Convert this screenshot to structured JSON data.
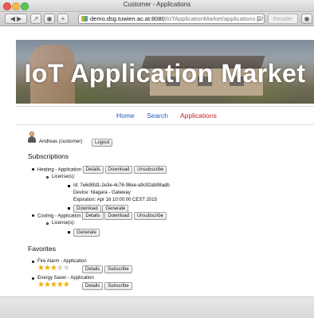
{
  "window": {
    "title": "Customer - Applications"
  },
  "toolbar": {
    "url_host": "demo.dsg.tuwien.ac.at:8080",
    "url_path": "/IoTApplicationMarket/applications.jsf",
    "reload_glyph": "C",
    "reader_label": "Reader",
    "add_glyph": "+"
  },
  "banner": {
    "title": "IoT Application Market"
  },
  "nav": {
    "items": [
      "Home",
      "Search",
      "Applications"
    ],
    "active": "Applications",
    "link_color": "#2255bb",
    "active_color": "#c62020"
  },
  "user": {
    "label": "Andreas (customer)",
    "logout_label": "Logout"
  },
  "subscriptions": {
    "heading": "Subscriptions",
    "items": [
      {
        "title": "Heating - Application",
        "buttons": [
          "Details",
          "Download",
          "Unsubscribe"
        ],
        "licenses_label": "License(s):",
        "license": {
          "id_line": "Id: 7e6d5fd1-2e3e-4c76-98ee-a9c92ab98adb",
          "device_line": "Device: Niagara - Gateway",
          "expiration_line": "Expiration: Apr 16 10:00:00 CEST 2015",
          "buttons": [
            "Download",
            "Generate"
          ]
        }
      },
      {
        "title": "Cooling - Application",
        "buttons": [
          "Details",
          "Download",
          "Unsubscribe"
        ],
        "licenses_label": "License(s):",
        "generate_label": "Generate"
      }
    ]
  },
  "favorites": {
    "heading": "Favorites",
    "items": [
      {
        "title": "Fire Alarm - Application",
        "rating": 3,
        "max_rating": 5,
        "buttons": [
          "Details",
          "Subscribe"
        ]
      },
      {
        "title": "Energy Saver - Application",
        "rating": 5,
        "max_rating": 5,
        "buttons": [
          "Details",
          "Subscribe"
        ]
      }
    ]
  },
  "colors": {
    "star_on": "#f0b000",
    "star_off": "#cfcfcf"
  }
}
